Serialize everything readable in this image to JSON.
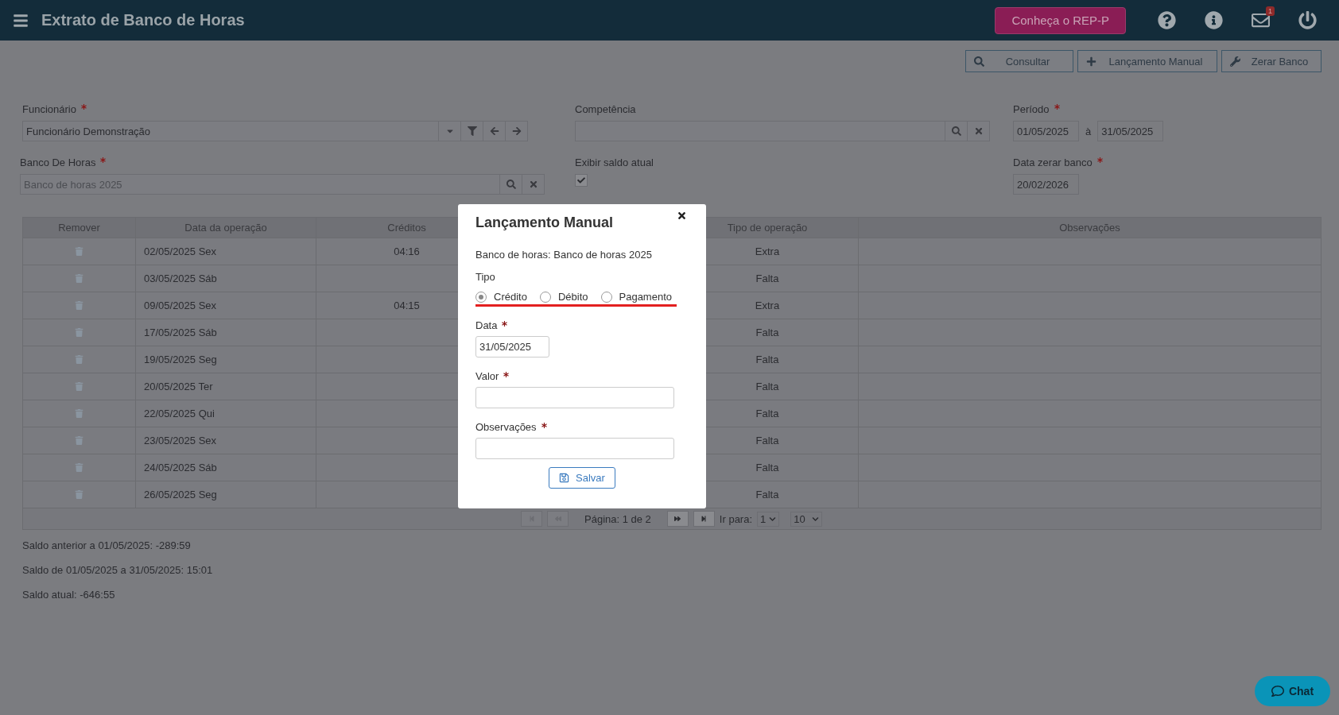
{
  "header": {
    "title": "Extrato de Banco de Horas",
    "promo_button": "Conheça o REP-P",
    "notification_count": "1"
  },
  "toolbar": [
    "Consultar",
    "Lançamento Manual",
    "Zerar Banco"
  ],
  "form": {
    "funcionario": {
      "label": "Funcionário",
      "required": true,
      "value": "Funcionário Demonstração"
    },
    "competencia": {
      "label": "Competência"
    },
    "periodo": {
      "label": "Período",
      "required": true,
      "from": "01/05/2025",
      "separator": "à",
      "to": "31/05/2025"
    },
    "banco": {
      "label": "Banco De Horas",
      "required": true,
      "placeholder": "Banco de horas 2025"
    },
    "exibir_saldo": {
      "label": "Exibir saldo atual",
      "checked": true
    },
    "data_zerar": {
      "label": "Data zerar banco",
      "required": true,
      "value": "20/02/2026"
    }
  },
  "table": {
    "columns": [
      "Remover",
      "Data da operação",
      "Créditos",
      "Tipo de operação",
      "Observações"
    ],
    "rows": [
      {
        "date": "02/05/2025 Sex",
        "credit": "04:16",
        "type": "Extra"
      },
      {
        "date": "03/05/2025 Sáb",
        "type": "Falta"
      },
      {
        "date": "09/05/2025 Sex",
        "credit": "04:15",
        "type": "Extra"
      },
      {
        "date": "17/05/2025 Sáb",
        "type": "Falta"
      },
      {
        "date": "19/05/2025 Seg",
        "type": "Falta"
      },
      {
        "date": "20/05/2025 Ter",
        "type": "Falta"
      },
      {
        "date": "22/05/2025 Qui",
        "type": "Falta"
      },
      {
        "date": "23/05/2025 Sex",
        "type": "Falta"
      },
      {
        "date": "24/05/2025 Sáb",
        "type": "Falta"
      },
      {
        "date": "26/05/2025 Seg",
        "type": "Falta"
      }
    ],
    "pagination": {
      "nav": [
        {
          "kind": "first",
          "disabled": true
        },
        {
          "kind": "prev",
          "disabled": true
        },
        {
          "kind": "next",
          "disabled": false
        },
        {
          "kind": "last",
          "disabled": false
        }
      ],
      "page_text": "Página: 1 de 2",
      "goto_label": "Ir para:",
      "goto_value": "1",
      "page_size": "10"
    }
  },
  "summary": [
    "Saldo anterior a 01/05/2025: -289:59",
    "Saldo de 01/05/2025 a 31/05/2025: 15:01",
    "Saldo atual: -646:55"
  ],
  "modal": {
    "title": "Lançamento Manual",
    "bank_line": "Banco de horas: Banco de horas 2025",
    "tipo_label": "Tipo",
    "options": [
      {
        "label": "Crédito",
        "selected": true
      },
      {
        "label": "Débito",
        "selected": false
      },
      {
        "label": "Pagamento",
        "selected": false
      }
    ],
    "data": {
      "label": "Data",
      "required": true,
      "value": "31/05/2025"
    },
    "valor": {
      "label": "Valor",
      "required": true
    },
    "observacoes": {
      "label": "Observações",
      "required": true
    },
    "save": "Salvar"
  },
  "chat": "Chat"
}
